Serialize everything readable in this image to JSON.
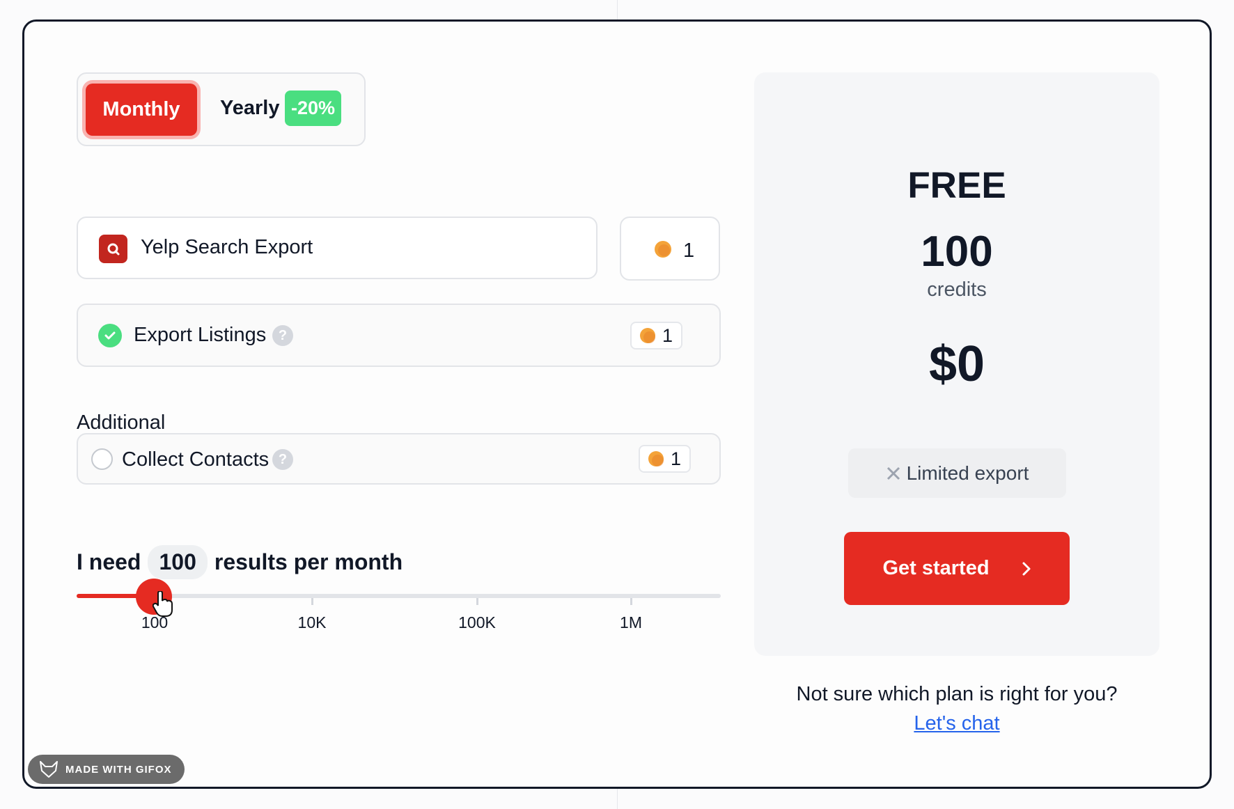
{
  "billing": {
    "monthly_label": "Monthly",
    "yearly_label": "Yearly",
    "yearly_discount": "-20%",
    "selected": "Monthly"
  },
  "tool": {
    "name": "Yelp Search Export",
    "icon": "search-icon",
    "credits": "1"
  },
  "features": {
    "export_listings": {
      "label": "Export Listings",
      "credits": "1",
      "checked": true
    },
    "additional_title": "Additional",
    "collect_contacts": {
      "label": "Collect Contacts",
      "credits": "1",
      "checked": false
    }
  },
  "volume": {
    "prefix": "I need",
    "value": "100",
    "suffix": "results per month",
    "ticks": [
      "100",
      "10K",
      "100K",
      "1M"
    ],
    "accent": "#e52b22"
  },
  "plan": {
    "name": "FREE",
    "credits": "100",
    "credits_unit": "credits",
    "price": "$0",
    "limitation": "Limited export",
    "cta_label": "Get started"
  },
  "help": {
    "question": "Not sure which plan is right for you?",
    "link": "Let's chat"
  },
  "watermark": "MADE WITH GIFOX",
  "colors": {
    "primary": "#e52b22",
    "success": "#4ade80",
    "coin": "#f4a339",
    "link": "#2563eb"
  }
}
